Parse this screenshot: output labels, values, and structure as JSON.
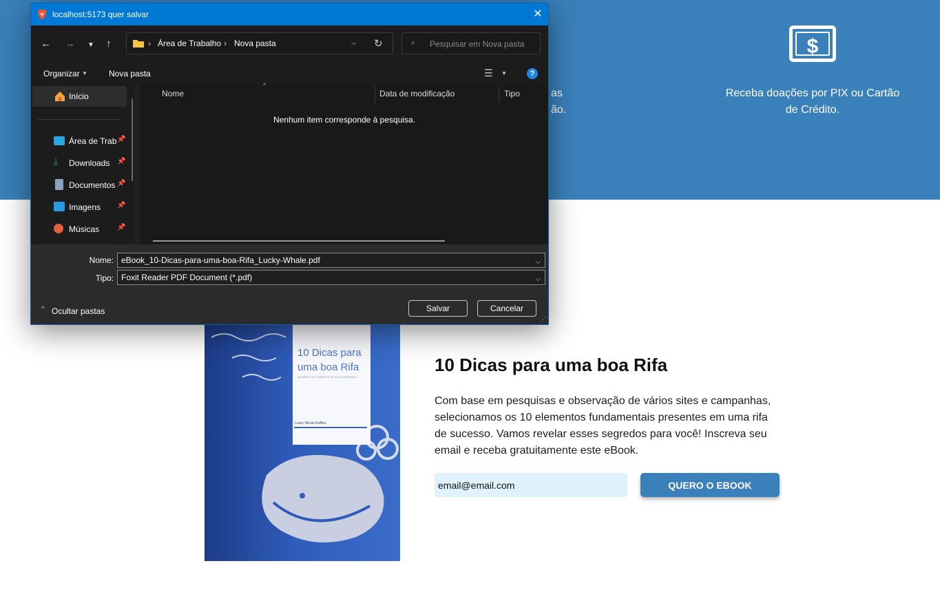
{
  "hero": {
    "partial_feature_text": "as\não.",
    "pix_feature_text": "Receba doações por PIX ou Cartão\nde Crédito."
  },
  "ebook": {
    "cover": {
      "title": "10 Dicas para uma boa Rifa",
      "subtitle": "AUMENTE AS CHANCES DE SUA CAMPANHA",
      "author": "Lucky Whale Raffles"
    },
    "heading": "10 Dicas para uma boa Rifa",
    "description": "Com base em pesquisas e observação de vários sites e campanhas, selecionamos os 10 elementos fundamentais presentes em uma rifa de sucesso. Vamos revelar esses segredos para você! Inscreva seu email e receba gratuitamente este eBook.",
    "email_value": "email@email.com",
    "button_label": "QUERO O EBOOK"
  },
  "dialog": {
    "title": "localhost:5173 quer salvar",
    "breadcrumb": [
      "Área de Trabalho",
      "Nova pasta"
    ],
    "search_placeholder": "Pesquisar em Nova pasta",
    "toolbar": {
      "organize": "Organizar",
      "new_folder": "Nova pasta"
    },
    "nav": {
      "home": "Início",
      "items": [
        {
          "label": "Área de Trabalho",
          "icon": "desktop-icon"
        },
        {
          "label": "Downloads",
          "icon": "download-icon"
        },
        {
          "label": "Documentos",
          "icon": "document-icon"
        },
        {
          "label": "Imagens",
          "icon": "image-icon"
        },
        {
          "label": "Músicas",
          "icon": "music-icon"
        }
      ]
    },
    "columns": [
      "Nome",
      "Data de modificação",
      "Tipo"
    ],
    "empty_message": "Nenhum item corresponde à pesquisa.",
    "name_label": "Nome:",
    "name_value": "eBook_10-Dicas-para-uma-boa-Rifa_Lucky-Whale.pdf",
    "type_label": "Tipo:",
    "type_value": "Foxit Reader PDF Document (*.pdf)",
    "hide_folders": "Ocultar pastas",
    "save_label": "Salvar",
    "cancel_label": "Cancelar"
  },
  "colors": {
    "hero_blue": "#3a80ba",
    "accent": "#0078d4",
    "input_bg": "#e0f2fd"
  }
}
